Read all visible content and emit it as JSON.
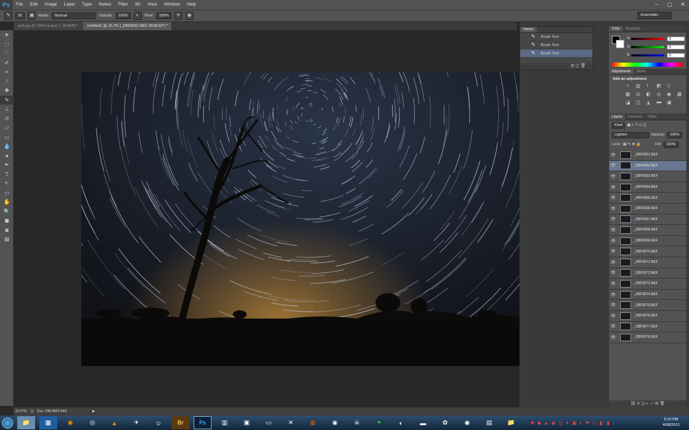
{
  "menubar": {
    "logo": "Ps",
    "items": [
      "File",
      "Edit",
      "Image",
      "Layer",
      "Type",
      "Select",
      "Filter",
      "3D",
      "View",
      "Window",
      "Help"
    ],
    "controls": [
      "–",
      "▢",
      "✕"
    ]
  },
  "options": {
    "brush_size": "30",
    "mode_label": "Mode:",
    "mode_value": "Normal",
    "opacity_label": "Opacity:",
    "opacity_value": "100%",
    "flow_label": "Flow:",
    "flow_value": "100%",
    "workspace": "Essentials"
  },
  "tabs": [
    {
      "label": "ps3.jpg @ 100% (Layer 1, RGB/8) *"
    },
    {
      "label": "Untitled1 @ 16.7% (_D8F6062.NEF, RGB/16*) *"
    }
  ],
  "history": {
    "tab": "History",
    "items": [
      "Brush Tool",
      "Brush Tool",
      "Brush Tool"
    ]
  },
  "color_panel": {
    "tabs": [
      "Color",
      "Swatches"
    ],
    "rows": [
      {
        "label": "R",
        "value": "0"
      },
      {
        "label": "G",
        "value": "0"
      },
      {
        "label": "B",
        "value": "0"
      }
    ]
  },
  "adjustments": {
    "tabs": [
      "Adjustments",
      "Styles"
    ],
    "title": "Add an adjustment"
  },
  "layers": {
    "tabs": [
      "Layers",
      "Channels",
      "Paths"
    ],
    "kind": "Kind",
    "blend": "Lighten",
    "opacity_label": "Opacity:",
    "opacity_value": "100%",
    "lock_label": "Lock:",
    "fill_label": "Fill:",
    "fill_value": "100%",
    "items": [
      "_D8F6061.NEF",
      "_D8F6062.NEF",
      "_D8F6063.NEF",
      "_D8F6064.NEF",
      "_D8F6065.NEF",
      "_D8F6066.NEF",
      "_D8F6067.NEF",
      "_D8F6068.NEF",
      "_D8F6069.NEF",
      "_D8F6070.NEF",
      "_D8F6071.NEF",
      "_D8F6072.NEF",
      "_D8F6073.NEF",
      "_D8F6074.NEF",
      "_D8F6075.NEF",
      "_D8F6076.NEF",
      "_D8F6077.NEF",
      "_D8F6078.NEF"
    ],
    "selected_index": 1
  },
  "status": {
    "zoom": "16.67%",
    "doc": "Doc: 206.9M/3.64G"
  },
  "clock": {
    "time": "5:10 PM",
    "date": "4/08/2013"
  },
  "colors": {
    "accent": "#31a8ff",
    "selection": "#66778f"
  }
}
